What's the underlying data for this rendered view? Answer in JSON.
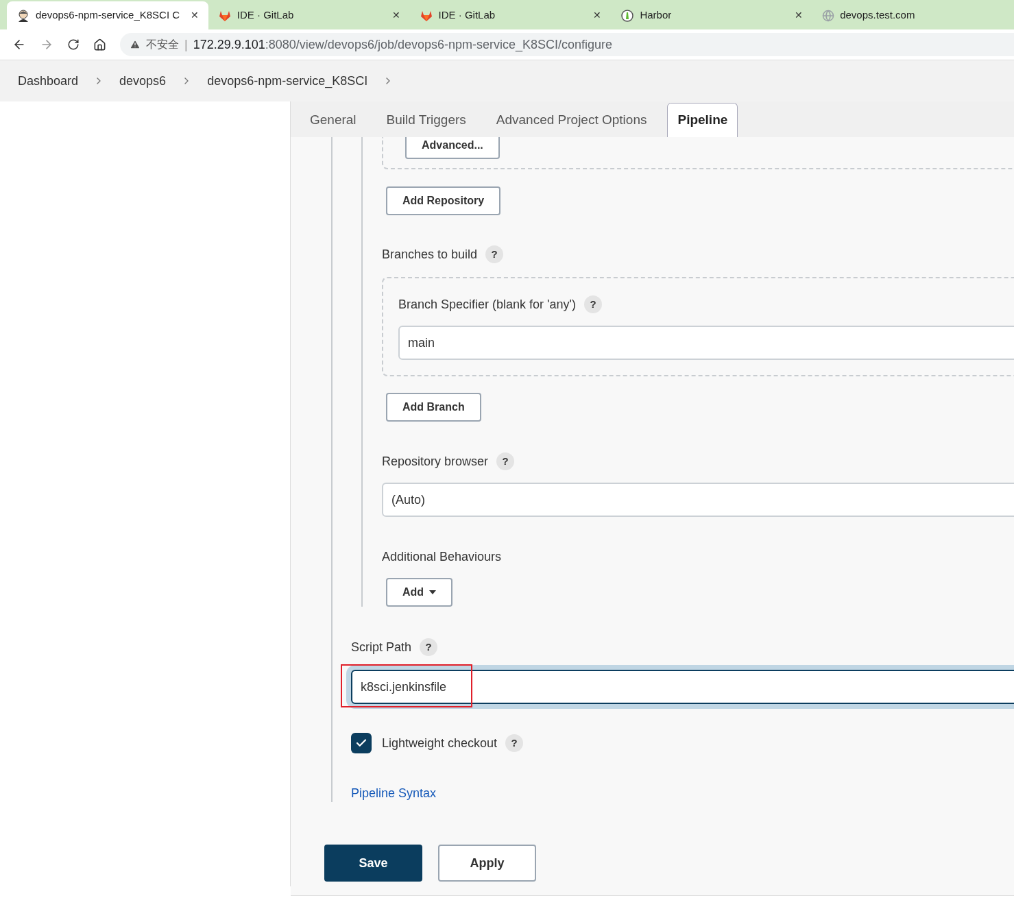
{
  "browser_tabs": [
    {
      "title": "devops6-npm-service_K8SCI C",
      "kind": "jenkins",
      "selected": true,
      "closable": true
    },
    {
      "title": "IDE · GitLab",
      "kind": "gitlab",
      "selected": false,
      "closable": true
    },
    {
      "title": "IDE · GitLab",
      "kind": "gitlab",
      "selected": false,
      "closable": true
    },
    {
      "title": "Harbor",
      "kind": "harbor",
      "selected": false,
      "closable": true
    },
    {
      "title": "devops.test.com",
      "kind": "globe",
      "selected": false,
      "closable": false
    }
  ],
  "close_glyph": "✕",
  "address_bar": {
    "security_label": "不安全",
    "separator": "|",
    "host": "172.29.9.101",
    "path": ":8080/view/devops6/job/devops6-npm-service_K8SCI/configure"
  },
  "breadcrumbs": [
    "Dashboard",
    "devops6",
    "devops6-npm-service_K8SCI"
  ],
  "config_tabs": [
    {
      "label": "General",
      "selected": false
    },
    {
      "label": "Build Triggers",
      "selected": false
    },
    {
      "label": "Advanced Project Options",
      "selected": false
    },
    {
      "label": "Pipeline",
      "selected": true
    }
  ],
  "advanced_button": "Advanced...",
  "add_repository_button": "Add Repository",
  "branches_label": "Branches to build",
  "help_glyph": "?",
  "branch_specifier": {
    "label": "Branch Specifier (blank for 'any')",
    "value": "main"
  },
  "add_branch_button": "Add Branch",
  "repository_browser": {
    "label": "Repository browser",
    "value": "(Auto)"
  },
  "additional_behaviours": {
    "label": "Additional Behaviours",
    "button": "Add"
  },
  "script_path": {
    "label": "Script Path",
    "value": "k8sci.jenkinsfile",
    "focused": true,
    "highlighted": true
  },
  "lightweight_checkout": {
    "label": "Lightweight checkout",
    "checked": true
  },
  "pipeline_syntax_link": "Pipeline Syntax",
  "actions": [
    {
      "label": "Save",
      "kind": "primary"
    },
    {
      "label": "Apply",
      "kind": "secondary"
    }
  ]
}
